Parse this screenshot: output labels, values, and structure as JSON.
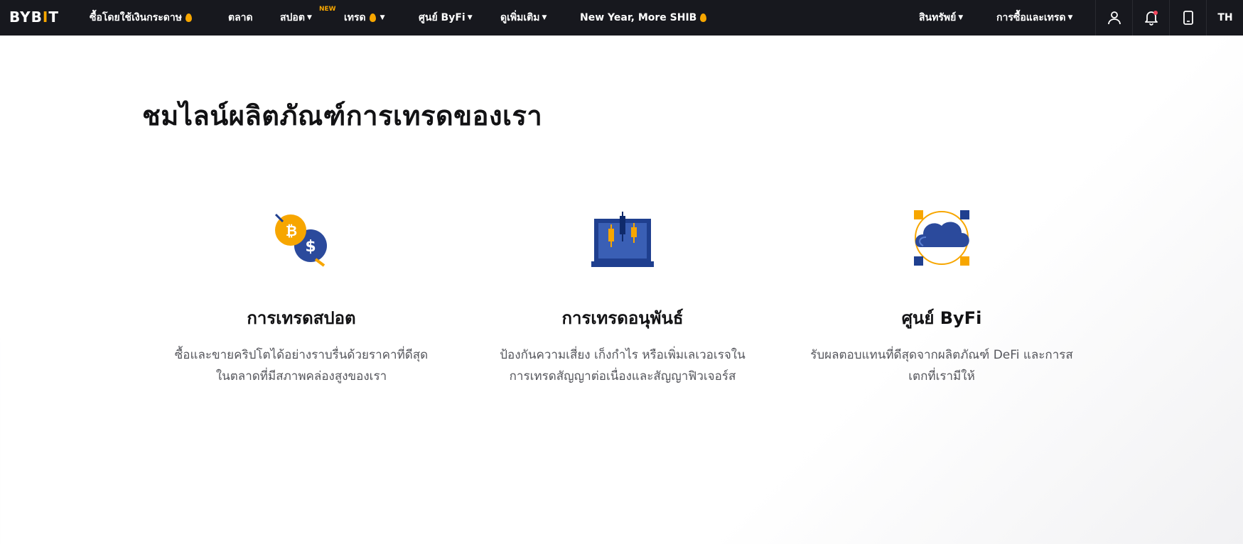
{
  "header": {
    "logo": "BYBIT",
    "nav": [
      {
        "label": "ซื้อโดยใช้เงินกระดาษ",
        "flame": true,
        "caret": false
      },
      {
        "label": "ตลาด",
        "flame": false,
        "caret": false
      },
      {
        "label": "สปอต",
        "flame": false,
        "caret": true,
        "badge": "NEW"
      },
      {
        "label": "เทรด",
        "flame": true,
        "caret": true
      },
      {
        "label": "ศูนย์ ByFi",
        "flame": false,
        "caret": true
      },
      {
        "label": "ดูเพิ่มเติม",
        "flame": false,
        "caret": true
      },
      {
        "label": "New Year, More SHIB",
        "flame": true,
        "caret": false
      }
    ],
    "right_nav": [
      {
        "label": "สินทรัพย์",
        "caret": true
      },
      {
        "label": "การซื้อและเทรด",
        "caret": true
      }
    ],
    "icons": [
      "user-icon",
      "bell-icon",
      "mobile-icon"
    ],
    "lang": "TH",
    "accent": "#f7a600",
    "bar_color": "#17181e"
  },
  "main": {
    "title": "ชมไลน์ผลิตภัณฑ์การเทรดของเรา",
    "cards": [
      {
        "icon": "spot-coins-icon",
        "title": "การเทรดสปอต",
        "desc": "ซื้อและขายคริปโตได้อย่างราบรื่นด้วยราคาที่ดีสุดในตลาดที่มีสภาพคล่องสูงของเรา"
      },
      {
        "icon": "derivatives-chart-icon",
        "title": "การเทรดอนุพันธ์",
        "desc": "ป้องกันความเสี่ยง เก็งกำไร หรือเพิ่มเลเวอเรจในการเทรดสัญญาต่อเนื่องและสัญญาฟิวเจอร์ส"
      },
      {
        "icon": "byfi-cloud-icon",
        "title": "ศูนย์ ByFi",
        "desc": "รับผลตอบแทนที่ดีสุดจากผลิตภัณฑ์ DeFi และการสเตกที่เรามีให้"
      }
    ]
  }
}
